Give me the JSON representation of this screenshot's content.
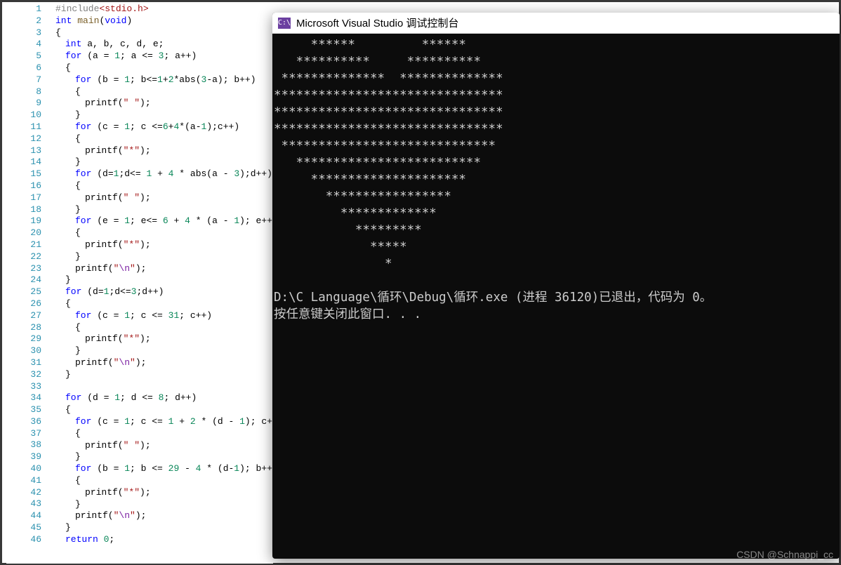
{
  "editor": {
    "lines": [
      {
        "n": 1,
        "indent": 0,
        "segs": [
          {
            "t": "#include",
            "c": "pp"
          },
          {
            "t": "<stdio.h>",
            "c": "str"
          }
        ]
      },
      {
        "n": 2,
        "indent": 0,
        "segs": [
          {
            "t": "int ",
            "c": "type"
          },
          {
            "t": "main",
            "c": "func"
          },
          {
            "t": "(",
            "c": "punc"
          },
          {
            "t": "void",
            "c": "type"
          },
          {
            "t": ")",
            "c": "punc"
          }
        ]
      },
      {
        "n": 3,
        "indent": 0,
        "segs": [
          {
            "t": "{",
            "c": "punc"
          }
        ]
      },
      {
        "n": 4,
        "indent": 1,
        "segs": [
          {
            "t": "int ",
            "c": "type"
          },
          {
            "t": "a, b, c, d, e;",
            "c": "ident"
          }
        ]
      },
      {
        "n": 5,
        "indent": 1,
        "segs": [
          {
            "t": "for ",
            "c": "kw"
          },
          {
            "t": "(a = ",
            "c": "ident"
          },
          {
            "t": "1",
            "c": "num"
          },
          {
            "t": "; a <= ",
            "c": "ident"
          },
          {
            "t": "3",
            "c": "num"
          },
          {
            "t": "; a++)",
            "c": "ident"
          }
        ]
      },
      {
        "n": 6,
        "indent": 1,
        "segs": [
          {
            "t": "{",
            "c": "punc"
          }
        ]
      },
      {
        "n": 7,
        "indent": 2,
        "segs": [
          {
            "t": "for ",
            "c": "kw"
          },
          {
            "t": "(b = ",
            "c": "ident"
          },
          {
            "t": "1",
            "c": "num"
          },
          {
            "t": "; b<=",
            "c": "ident"
          },
          {
            "t": "1",
            "c": "num"
          },
          {
            "t": "+",
            "c": "ident"
          },
          {
            "t": "2",
            "c": "num"
          },
          {
            "t": "*abs(",
            "c": "ident"
          },
          {
            "t": "3",
            "c": "num"
          },
          {
            "t": "-a); b++)",
            "c": "ident"
          }
        ]
      },
      {
        "n": 8,
        "indent": 2,
        "segs": [
          {
            "t": "{",
            "c": "punc"
          }
        ]
      },
      {
        "n": 9,
        "indent": 3,
        "segs": [
          {
            "t": "printf(",
            "c": "ident"
          },
          {
            "t": "\" \"",
            "c": "str"
          },
          {
            "t": ");",
            "c": "ident"
          }
        ]
      },
      {
        "n": 10,
        "indent": 2,
        "segs": [
          {
            "t": "}",
            "c": "punc"
          }
        ]
      },
      {
        "n": 11,
        "indent": 2,
        "segs": [
          {
            "t": "for ",
            "c": "kw"
          },
          {
            "t": "(c = ",
            "c": "ident"
          },
          {
            "t": "1",
            "c": "num"
          },
          {
            "t": "; c <=",
            "c": "ident"
          },
          {
            "t": "6",
            "c": "num"
          },
          {
            "t": "+",
            "c": "ident"
          },
          {
            "t": "4",
            "c": "num"
          },
          {
            "t": "*(a-",
            "c": "ident"
          },
          {
            "t": "1",
            "c": "num"
          },
          {
            "t": ");c++)",
            "c": "ident"
          }
        ]
      },
      {
        "n": 12,
        "indent": 2,
        "segs": [
          {
            "t": "{",
            "c": "punc"
          }
        ]
      },
      {
        "n": 13,
        "indent": 3,
        "segs": [
          {
            "t": "printf(",
            "c": "ident"
          },
          {
            "t": "\"*\"",
            "c": "str"
          },
          {
            "t": ");",
            "c": "ident"
          }
        ]
      },
      {
        "n": 14,
        "indent": 2,
        "segs": [
          {
            "t": "}",
            "c": "punc"
          }
        ]
      },
      {
        "n": 15,
        "indent": 2,
        "segs": [
          {
            "t": "for ",
            "c": "kw"
          },
          {
            "t": "(d=",
            "c": "ident"
          },
          {
            "t": "1",
            "c": "num"
          },
          {
            "t": ";d<= ",
            "c": "ident"
          },
          {
            "t": "1",
            "c": "num"
          },
          {
            "t": " + ",
            "c": "ident"
          },
          {
            "t": "4",
            "c": "num"
          },
          {
            "t": " * abs(a - ",
            "c": "ident"
          },
          {
            "t": "3",
            "c": "num"
          },
          {
            "t": ");d++)",
            "c": "ident"
          }
        ]
      },
      {
        "n": 16,
        "indent": 2,
        "segs": [
          {
            "t": "{",
            "c": "punc"
          }
        ]
      },
      {
        "n": 17,
        "indent": 3,
        "segs": [
          {
            "t": "printf(",
            "c": "ident"
          },
          {
            "t": "\" \"",
            "c": "str"
          },
          {
            "t": ");",
            "c": "ident"
          }
        ]
      },
      {
        "n": 18,
        "indent": 2,
        "segs": [
          {
            "t": "}",
            "c": "punc"
          }
        ]
      },
      {
        "n": 19,
        "indent": 2,
        "segs": [
          {
            "t": "for ",
            "c": "kw"
          },
          {
            "t": "(e = ",
            "c": "ident"
          },
          {
            "t": "1",
            "c": "num"
          },
          {
            "t": "; e<= ",
            "c": "ident"
          },
          {
            "t": "6",
            "c": "num"
          },
          {
            "t": " + ",
            "c": "ident"
          },
          {
            "t": "4",
            "c": "num"
          },
          {
            "t": " * (a - ",
            "c": "ident"
          },
          {
            "t": "1",
            "c": "num"
          },
          {
            "t": "); e++)",
            "c": "ident"
          }
        ]
      },
      {
        "n": 20,
        "indent": 2,
        "segs": [
          {
            "t": "{",
            "c": "punc"
          }
        ]
      },
      {
        "n": 21,
        "indent": 3,
        "segs": [
          {
            "t": "printf(",
            "c": "ident"
          },
          {
            "t": "\"*\"",
            "c": "str"
          },
          {
            "t": ");",
            "c": "ident"
          }
        ]
      },
      {
        "n": 22,
        "indent": 2,
        "segs": [
          {
            "t": "}",
            "c": "punc"
          }
        ]
      },
      {
        "n": 23,
        "indent": 2,
        "segs": [
          {
            "t": "printf(",
            "c": "ident"
          },
          {
            "t": "\"",
            "c": "str"
          },
          {
            "t": "\\n",
            "c": "esc"
          },
          {
            "t": "\"",
            "c": "str"
          },
          {
            "t": ");",
            "c": "ident"
          }
        ]
      },
      {
        "n": 24,
        "indent": 1,
        "segs": [
          {
            "t": "}",
            "c": "punc"
          }
        ]
      },
      {
        "n": 25,
        "indent": 1,
        "segs": [
          {
            "t": "for ",
            "c": "kw"
          },
          {
            "t": "(d=",
            "c": "ident"
          },
          {
            "t": "1",
            "c": "num"
          },
          {
            "t": ";d<=",
            "c": "ident"
          },
          {
            "t": "3",
            "c": "num"
          },
          {
            "t": ";d++)",
            "c": "ident"
          }
        ]
      },
      {
        "n": 26,
        "indent": 1,
        "segs": [
          {
            "t": "{",
            "c": "punc"
          }
        ]
      },
      {
        "n": 27,
        "indent": 2,
        "segs": [
          {
            "t": "for ",
            "c": "kw"
          },
          {
            "t": "(c = ",
            "c": "ident"
          },
          {
            "t": "1",
            "c": "num"
          },
          {
            "t": "; c <= ",
            "c": "ident"
          },
          {
            "t": "31",
            "c": "num"
          },
          {
            "t": "; c++)",
            "c": "ident"
          }
        ]
      },
      {
        "n": 28,
        "indent": 2,
        "segs": [
          {
            "t": "{",
            "c": "punc"
          }
        ]
      },
      {
        "n": 29,
        "indent": 3,
        "segs": [
          {
            "t": "printf(",
            "c": "ident"
          },
          {
            "t": "\"*\"",
            "c": "str"
          },
          {
            "t": ");",
            "c": "ident"
          }
        ]
      },
      {
        "n": 30,
        "indent": 2,
        "segs": [
          {
            "t": "}",
            "c": "punc"
          }
        ]
      },
      {
        "n": 31,
        "indent": 2,
        "segs": [
          {
            "t": "printf(",
            "c": "ident"
          },
          {
            "t": "\"",
            "c": "str"
          },
          {
            "t": "\\n",
            "c": "esc"
          },
          {
            "t": "\"",
            "c": "str"
          },
          {
            "t": ");",
            "c": "ident"
          }
        ]
      },
      {
        "n": 32,
        "indent": 1,
        "segs": [
          {
            "t": "}",
            "c": "punc"
          }
        ]
      },
      {
        "n": 33,
        "indent": 1,
        "segs": []
      },
      {
        "n": 34,
        "indent": 1,
        "segs": [
          {
            "t": "for ",
            "c": "kw"
          },
          {
            "t": "(d = ",
            "c": "ident"
          },
          {
            "t": "1",
            "c": "num"
          },
          {
            "t": "; d <= ",
            "c": "ident"
          },
          {
            "t": "8",
            "c": "num"
          },
          {
            "t": "; d++)",
            "c": "ident"
          }
        ]
      },
      {
        "n": 35,
        "indent": 1,
        "segs": [
          {
            "t": "{",
            "c": "punc"
          }
        ]
      },
      {
        "n": 36,
        "indent": 2,
        "segs": [
          {
            "t": "for ",
            "c": "kw"
          },
          {
            "t": "(c = ",
            "c": "ident"
          },
          {
            "t": "1",
            "c": "num"
          },
          {
            "t": "; c <= ",
            "c": "ident"
          },
          {
            "t": "1",
            "c": "num"
          },
          {
            "t": " + ",
            "c": "ident"
          },
          {
            "t": "2",
            "c": "num"
          },
          {
            "t": " * (d - ",
            "c": "ident"
          },
          {
            "t": "1",
            "c": "num"
          },
          {
            "t": "); c++)",
            "c": "ident"
          }
        ]
      },
      {
        "n": 37,
        "indent": 2,
        "segs": [
          {
            "t": "{",
            "c": "punc"
          }
        ]
      },
      {
        "n": 38,
        "indent": 3,
        "segs": [
          {
            "t": "printf(",
            "c": "ident"
          },
          {
            "t": "\" \"",
            "c": "str"
          },
          {
            "t": ");",
            "c": "ident"
          }
        ]
      },
      {
        "n": 39,
        "indent": 2,
        "segs": [
          {
            "t": "}",
            "c": "punc"
          }
        ]
      },
      {
        "n": 40,
        "indent": 2,
        "segs": [
          {
            "t": "for ",
            "c": "kw"
          },
          {
            "t": "(b = ",
            "c": "ident"
          },
          {
            "t": "1",
            "c": "num"
          },
          {
            "t": "; b <= ",
            "c": "ident"
          },
          {
            "t": "29",
            "c": "num"
          },
          {
            "t": " - ",
            "c": "ident"
          },
          {
            "t": "4",
            "c": "num"
          },
          {
            "t": " * (d-",
            "c": "ident"
          },
          {
            "t": "1",
            "c": "num"
          },
          {
            "t": "); b++)",
            "c": "ident"
          }
        ]
      },
      {
        "n": 41,
        "indent": 2,
        "segs": [
          {
            "t": "{",
            "c": "punc"
          }
        ]
      },
      {
        "n": 42,
        "indent": 3,
        "segs": [
          {
            "t": "printf(",
            "c": "ident"
          },
          {
            "t": "\"*\"",
            "c": "str"
          },
          {
            "t": ");",
            "c": "ident"
          }
        ]
      },
      {
        "n": 43,
        "indent": 2,
        "segs": [
          {
            "t": "}",
            "c": "punc"
          }
        ]
      },
      {
        "n": 44,
        "indent": 2,
        "segs": [
          {
            "t": "printf(",
            "c": "ident"
          },
          {
            "t": "\"",
            "c": "str"
          },
          {
            "t": "\\n",
            "c": "esc"
          },
          {
            "t": "\"",
            "c": "str"
          },
          {
            "t": ");",
            "c": "ident"
          }
        ]
      },
      {
        "n": 45,
        "indent": 1,
        "segs": [
          {
            "t": "}",
            "c": "punc"
          }
        ]
      },
      {
        "n": 46,
        "indent": 1,
        "segs": [
          {
            "t": "return ",
            "c": "kw"
          },
          {
            "t": "0",
            "c": "num"
          },
          {
            "t": ";",
            "c": "ident"
          }
        ]
      }
    ]
  },
  "console": {
    "title_icon": "C:\\",
    "title": "Microsoft Visual Studio 调试控制台",
    "output": "     ******         ******\n   **********     **********\n **************  **************\n*******************************\n*******************************\n*******************************\n *****************************\n   *************************\n     *********************\n       *****************\n         *************\n           *********\n             *****\n               *\n\nD:\\C Language\\循环\\Debug\\循环.exe (进程 36120)已退出，代码为 0。\n按任意键关闭此窗口. . ."
  },
  "watermark": "CSDN @Schnappi_cc"
}
